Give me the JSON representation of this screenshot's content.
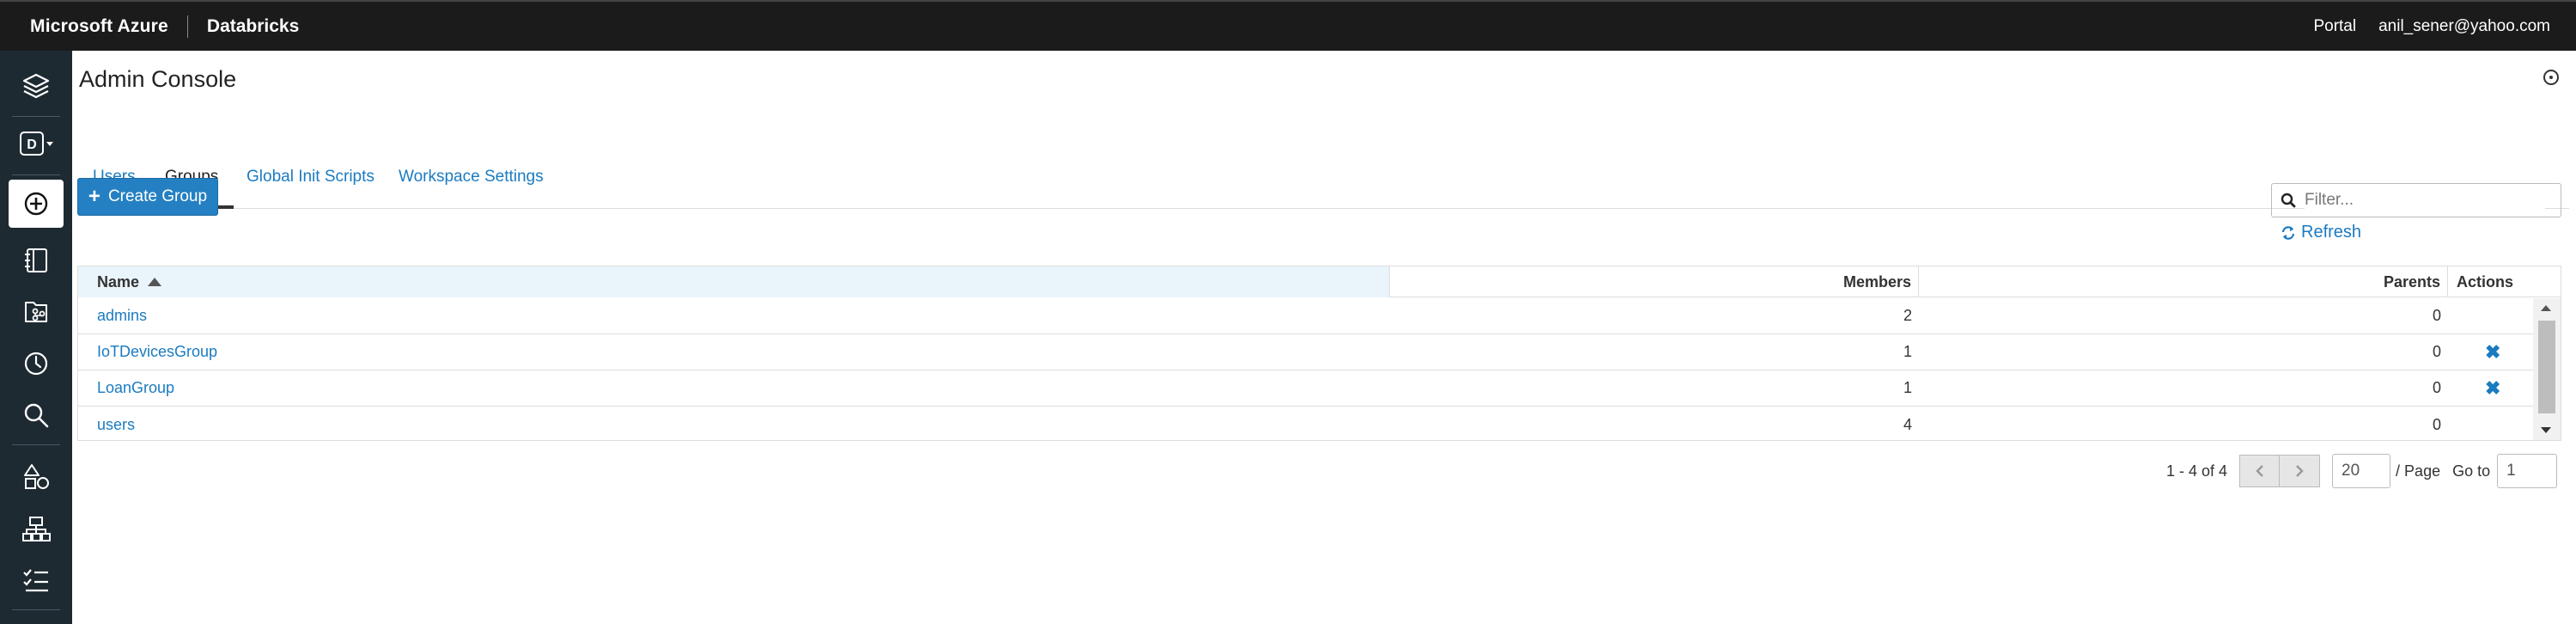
{
  "topbar": {
    "brand": "Microsoft Azure",
    "product": "Databricks",
    "portal_label": "Portal",
    "user_email": "anil_sener@yahoo.com"
  },
  "sidebar": {
    "workspace_letter": "D",
    "items": [
      {
        "icon": "layers-icon"
      },
      {
        "icon": "workspace-switcher-icon"
      },
      {
        "icon": "create-plus-icon"
      },
      {
        "icon": "notebook-icon"
      },
      {
        "icon": "repos-icon"
      },
      {
        "icon": "clock-icon"
      },
      {
        "icon": "search-icon"
      },
      {
        "icon": "shapes-icon"
      },
      {
        "icon": "cluster-icon"
      },
      {
        "icon": "task-list-icon"
      }
    ]
  },
  "page": {
    "title": "Admin Console"
  },
  "tabs": [
    {
      "label": "Users",
      "active": false
    },
    {
      "label": "Groups",
      "active": true
    },
    {
      "label": "Global Init Scripts",
      "active": false
    },
    {
      "label": "Workspace Settings",
      "active": false
    }
  ],
  "toolbar": {
    "create_label": "Create Group",
    "filter_placeholder": "Filter...",
    "refresh_label": "Refresh"
  },
  "table": {
    "columns": [
      "Name",
      "Members",
      "Parents",
      "Actions"
    ],
    "rows": [
      {
        "name": "admins",
        "members": "2",
        "parents": "0",
        "deletable": false
      },
      {
        "name": "IoTDevicesGroup",
        "members": "1",
        "parents": "0",
        "deletable": true
      },
      {
        "name": "LoanGroup",
        "members": "1",
        "parents": "0",
        "deletable": true
      },
      {
        "name": "users",
        "members": "4",
        "parents": "0",
        "deletable": false
      }
    ],
    "delete_glyph": "✖"
  },
  "pagination": {
    "range_text": "1 - 4 of 4",
    "page_size": "20",
    "per_page_label": "/ Page",
    "goto_label": "Go to",
    "goto_value": "1"
  },
  "colors": {
    "link": "#1b7bc0",
    "primary_button": "#2580c3",
    "topbar": "#1b1b1b",
    "sidebar": "#1e2a32"
  }
}
